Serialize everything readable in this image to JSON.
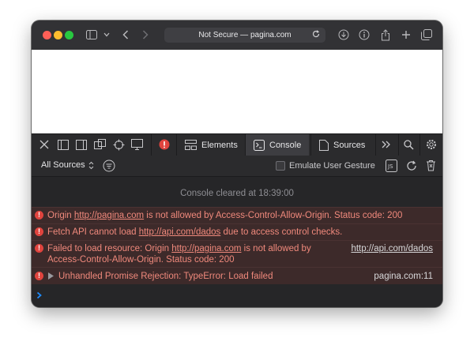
{
  "browser": {
    "address": "Not Secure — pagina.com"
  },
  "devtools": {
    "tabs": [
      {
        "label": "Elements"
      },
      {
        "label": "Console"
      },
      {
        "label": "Sources"
      }
    ],
    "sources_filter": "All Sources",
    "emulate_label": "Emulate User Gesture"
  },
  "console": {
    "cleared": "Console cleared at 18:39:00",
    "messages": [
      {
        "pre": "Origin ",
        "link": "http://pagina.com",
        "post": " is not allowed by Access-Control-Allow-Origin. Status code: 200"
      },
      {
        "pre": "Fetch API cannot load ",
        "link": "http://api.com/dados",
        "post": " due to access control checks."
      },
      {
        "line1_pre": "Failed to load resource: Origin ",
        "link": "http://pagina.com",
        "line1_post": " is not allowed by",
        "line2": "Access-Control-Allow-Origin. Status code: 200",
        "source": "http://api.com/dados"
      },
      {
        "text": "Unhandled Promise Rejection: TypeError: Load failed",
        "source": "pagina.com:11"
      }
    ]
  },
  "colors": {
    "error_text": "#f0897c",
    "error_bg": "#3d2a2a",
    "accent": "#1e8cff"
  }
}
